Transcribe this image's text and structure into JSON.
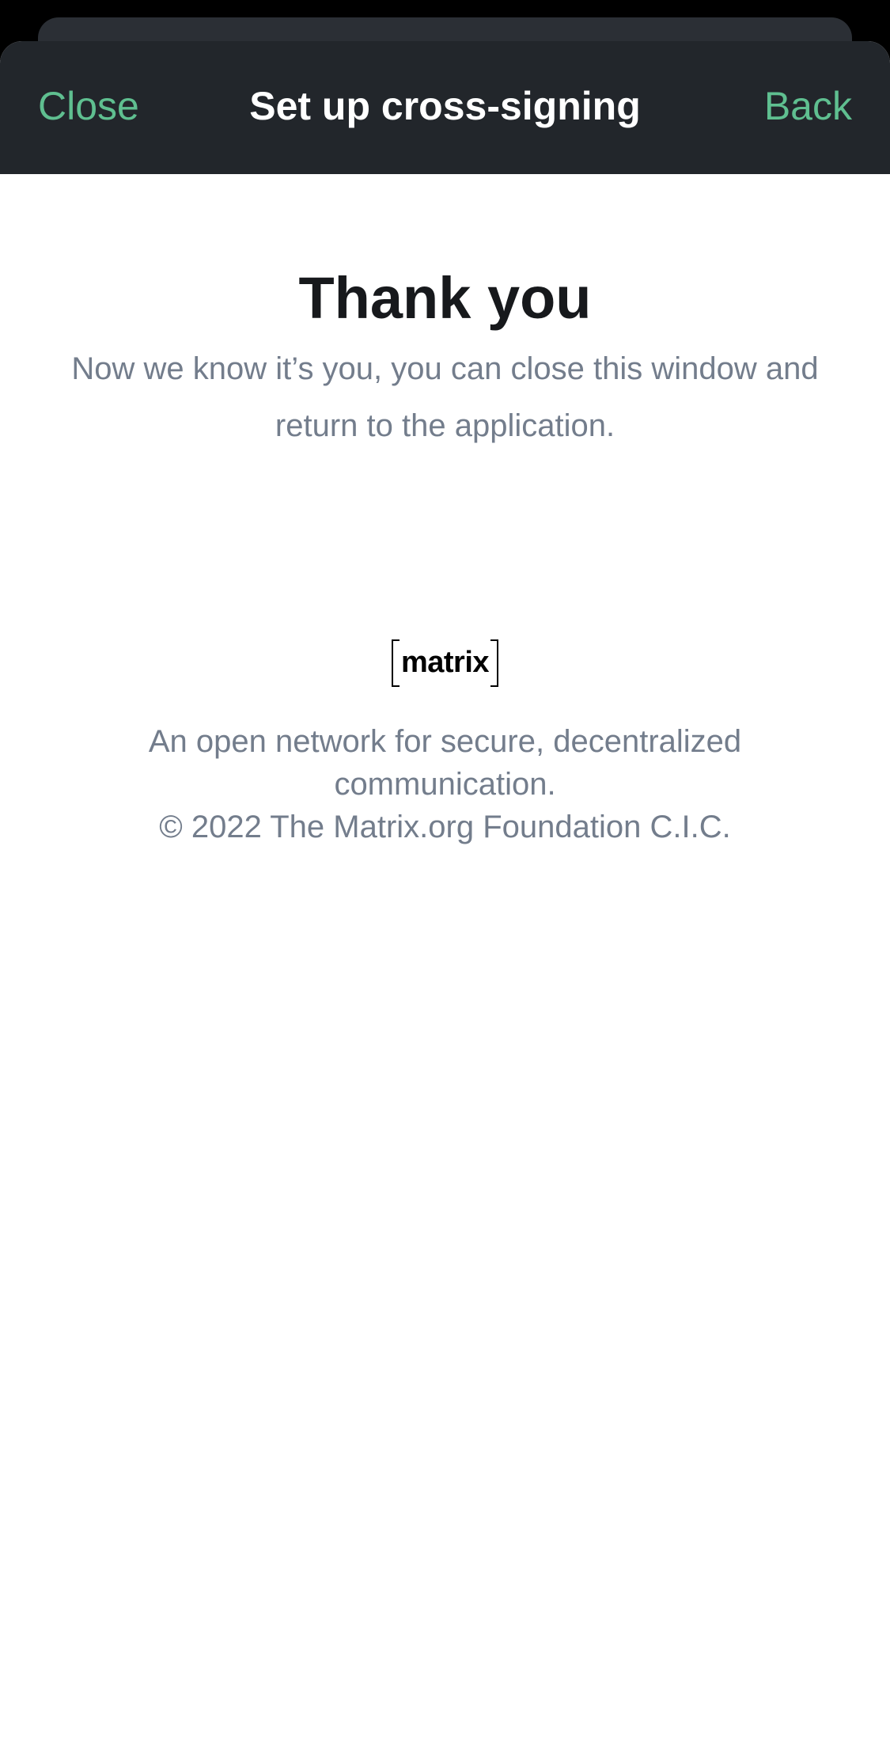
{
  "nav": {
    "close_label": "Close",
    "title": "Set up cross-signing",
    "back_label": "Back"
  },
  "main": {
    "heading": "Thank you",
    "message": "Now we know it’s you, you can close this window and return to the application."
  },
  "footer": {
    "logo_text": "matrix",
    "tagline": "An open network for secure, decentralized communication.",
    "copyright": "© 2022 The Matrix.org Foundation C.I.C."
  },
  "colors": {
    "accent": "#5fbf90",
    "navbar_bg": "#22262b",
    "secondary_text": "#737d8c",
    "heading_text": "#17191c"
  }
}
